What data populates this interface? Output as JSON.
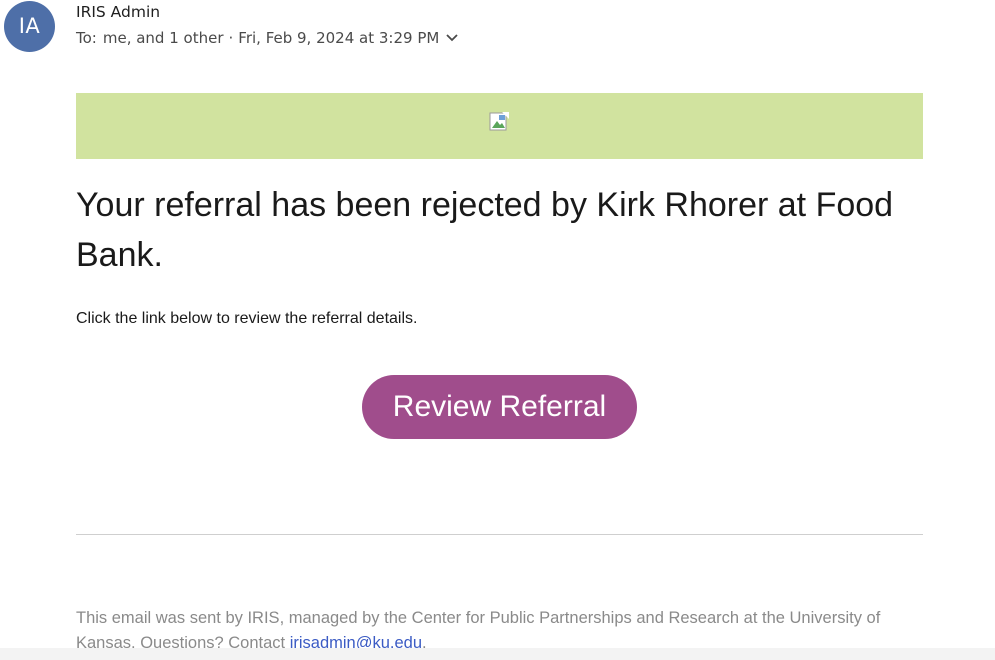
{
  "header": {
    "avatar_initials": "IA",
    "avatar_color": "#4e6fa8",
    "sender_name": "IRIS Admin",
    "to_prefix": "To:",
    "recipients": "me, and 1 other",
    "separator": "·",
    "date": "Fri, Feb 9, 2024 at 3:29 PM",
    "expand_icon": "chevron-down-icon"
  },
  "email": {
    "banner": {
      "color": "#d1e39f",
      "image_icon": "broken-image-icon"
    },
    "headline": "Your referral has been rejected by Kirk Rhorer at Food Bank.",
    "instruction": "Click the link below to review the referral details.",
    "cta_label": "Review Referral",
    "cta_color": "#a04d8c",
    "footer": {
      "text": "This email was sent by IRIS, managed by the Center for Public Partnerships and Research at the University of Kansas. Questions? Contact ",
      "email": "irisadmin@ku.edu",
      "suffix": "."
    }
  }
}
